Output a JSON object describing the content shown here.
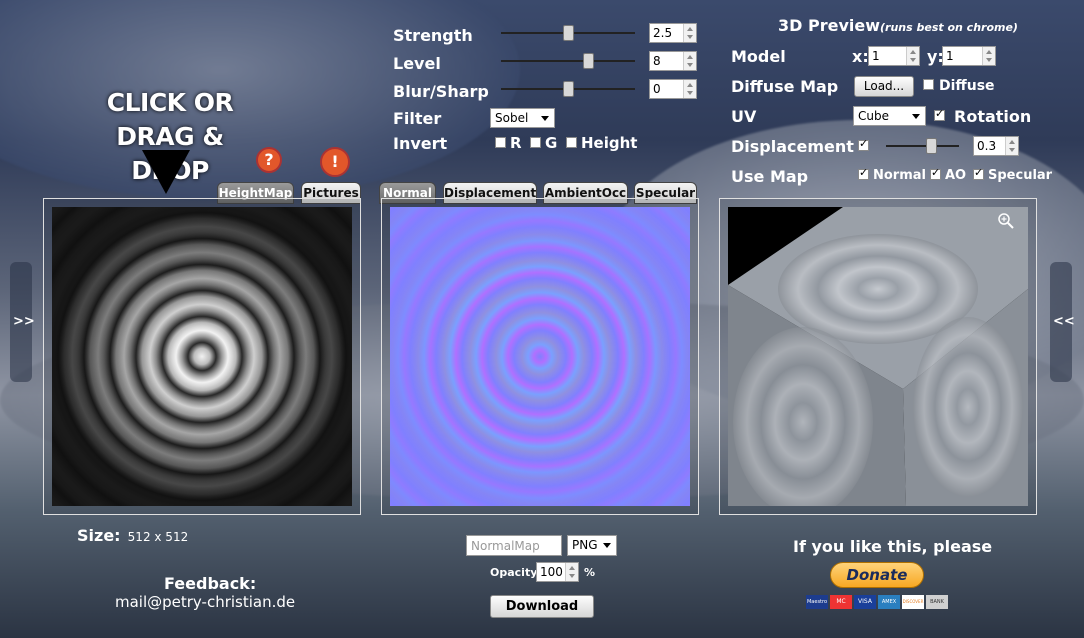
{
  "drop_hint": {
    "line1": "CLICK OR",
    "line2": "DRAG & DROP"
  },
  "left_tabs": [
    {
      "label": "HeightMap",
      "selected": true
    },
    {
      "label": "Pictures",
      "selected": false
    }
  ],
  "help_icons": [
    {
      "glyph": "?"
    },
    {
      "glyph": "!"
    }
  ],
  "controls": {
    "strength": {
      "label": "Strength",
      "value": "2.5",
      "slider_fraction": 0.5
    },
    "level": {
      "label": "Level",
      "value": "8",
      "slider_fraction": 0.65
    },
    "blur_sharp": {
      "label": "Blur/Sharp",
      "value": "0",
      "slider_fraction": 0.5
    },
    "filter": {
      "label": "Filter",
      "value": "Sobel"
    },
    "invert": {
      "label": "Invert",
      "options": [
        {
          "label": "R",
          "checked": false
        },
        {
          "label": "G",
          "checked": false
        },
        {
          "label": "Height",
          "checked": false
        }
      ]
    }
  },
  "middle_tabs": [
    {
      "label": "Normal",
      "selected": true
    },
    {
      "label": "Displacement",
      "selected": false
    },
    {
      "label": "AmbientOcc",
      "selected": false
    },
    {
      "label": "Specular",
      "selected": false
    }
  ],
  "preview3d": {
    "title": "3D Preview",
    "subtitle": "(runs best on chrome)",
    "model_label": "Model",
    "x_label": "x:",
    "x_value": "1",
    "y_label": "y:",
    "y_value": "1",
    "diffuse_label": "Diffuse Map",
    "load_button": "Load...",
    "diffuse_cb_label": "Diffuse",
    "diffuse_checked": false,
    "uv_label": "UV",
    "uv_value": "Cube",
    "rotation_label": "Rotation",
    "rotation_checked": true,
    "displacement_label": "Displacement",
    "displacement_checked": true,
    "displacement_value": "0.3",
    "displacement_fraction": 0.6,
    "use_map_label": "Use Map",
    "use_maps": [
      {
        "label": "Normal",
        "checked": true
      },
      {
        "label": "AO",
        "checked": true
      },
      {
        "label": "Specular",
        "checked": true
      }
    ]
  },
  "size": {
    "label": "Size:",
    "value": "512 x 512"
  },
  "feedback": {
    "label": "Feedback:",
    "email": "mail@petry-christian.de"
  },
  "export": {
    "filename_placeholder": "NormalMap",
    "format": "PNG",
    "opacity_label": "Opacity",
    "opacity_value": "100",
    "percent": "%",
    "download_label": "Download"
  },
  "donate": {
    "text": "If you like this, please",
    "button": "Donate",
    "cards": [
      "Maestro",
      "MC",
      "VISA",
      "AMEX",
      "DISCOVER",
      "BANK"
    ]
  },
  "side_buttons": {
    "left": ">>",
    "right": "<<"
  },
  "colors": {
    "accent_orange": "#f7a823",
    "help_orange": "#e2572a",
    "normal_blue": "#8080ff"
  }
}
